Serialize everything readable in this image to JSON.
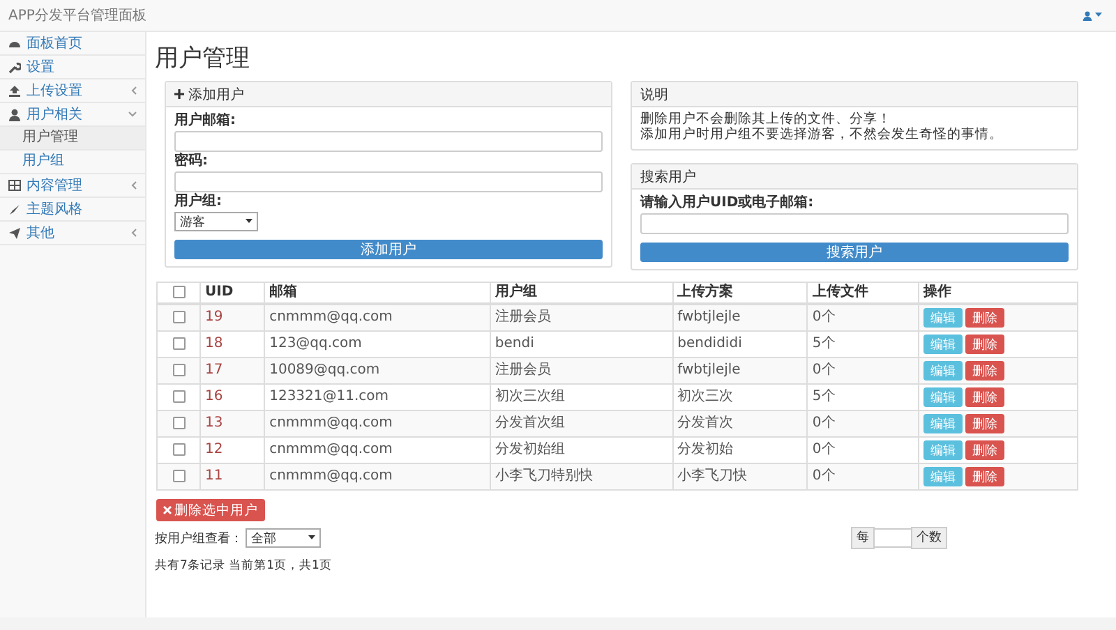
{
  "navbar": {
    "brand": "APP分发平台管理面板"
  },
  "sidebar": {
    "items": [
      {
        "label": "面板首页",
        "kind": "link"
      },
      {
        "label": "设置",
        "kind": "link"
      },
      {
        "label": "上传设置",
        "kind": "menu",
        "expanded": false
      },
      {
        "label": "用户相关",
        "kind": "menu",
        "expanded": true,
        "children": [
          {
            "label": "用户管理",
            "selected": true
          },
          {
            "label": "用户组",
            "selected": false
          }
        ]
      },
      {
        "label": "内容管理",
        "kind": "menu",
        "expanded": false
      },
      {
        "label": "主题风格",
        "kind": "link"
      },
      {
        "label": "其他",
        "kind": "menu",
        "expanded": false
      }
    ]
  },
  "page_title": "用户管理",
  "add_user_panel": {
    "title": "添加用户",
    "fields": [
      {
        "label": "用户邮箱:"
      },
      {
        "label": "密码:"
      }
    ],
    "group_label": "用户组:",
    "group_value": "游客",
    "submit": "添加用户"
  },
  "notice_panel": {
    "title": "说明",
    "lines": [
      "删除用户不会删除其上传的文件、分享！",
      "添加用户时用户组不要选择游客，不然会发生奇怪的事情。"
    ]
  },
  "search_panel": {
    "title": "搜索用户",
    "label": "请输入用户UID或电子邮箱:",
    "submit": "搜索用户"
  },
  "table": {
    "header_checked": false,
    "columns": [
      "UID",
      "邮箱",
      "用户组",
      "上传方案",
      "上传文件",
      "操作"
    ],
    "rows": [
      {
        "checked": false,
        "cells": [
          "19",
          "cnmmm@qq.com",
          "注册会员",
          "fwbtjlejle",
          "0个"
        ],
        "actions": [
          "编辑",
          "删除"
        ]
      },
      {
        "checked": false,
        "cells": [
          "18",
          "123@qq.com",
          "bendi",
          "bendididi",
          "5个"
        ],
        "actions": [
          "编辑",
          "删除"
        ]
      },
      {
        "checked": false,
        "cells": [
          "17",
          "10089@qq.com",
          "注册会员",
          "fwbtjlejle",
          "0个"
        ],
        "actions": [
          "编辑",
          "删除"
        ]
      },
      {
        "checked": false,
        "cells": [
          "16",
          "123321@11.com",
          "初次三次组",
          "初次三次",
          "5个"
        ],
        "actions": [
          "编辑",
          "删除"
        ]
      },
      {
        "checked": false,
        "cells": [
          "13",
          "cnmmm@qq.com",
          "分发首次组",
          "分发首次",
          "0个"
        ],
        "actions": [
          "编辑",
          "删除"
        ]
      },
      {
        "checked": false,
        "cells": [
          "12",
          "cnmmm@qq.com",
          "分发初始组",
          "分发初始",
          "0个"
        ],
        "actions": [
          "编辑",
          "删除"
        ]
      },
      {
        "checked": false,
        "cells": [
          "11",
          "cnmmm@qq.com",
          "小李飞刀特别快",
          "小李飞刀快",
          "0个"
        ],
        "actions": [
          "编辑",
          "删除"
        ]
      }
    ]
  },
  "bulk_delete": "删除选中用户",
  "filter": {
    "label": "按用户组查看：",
    "value": "全部"
  },
  "per_page": {
    "prefix": "每",
    "suffix": "个数"
  },
  "summary": "共有7条记录 当前第1页，共1页"
}
